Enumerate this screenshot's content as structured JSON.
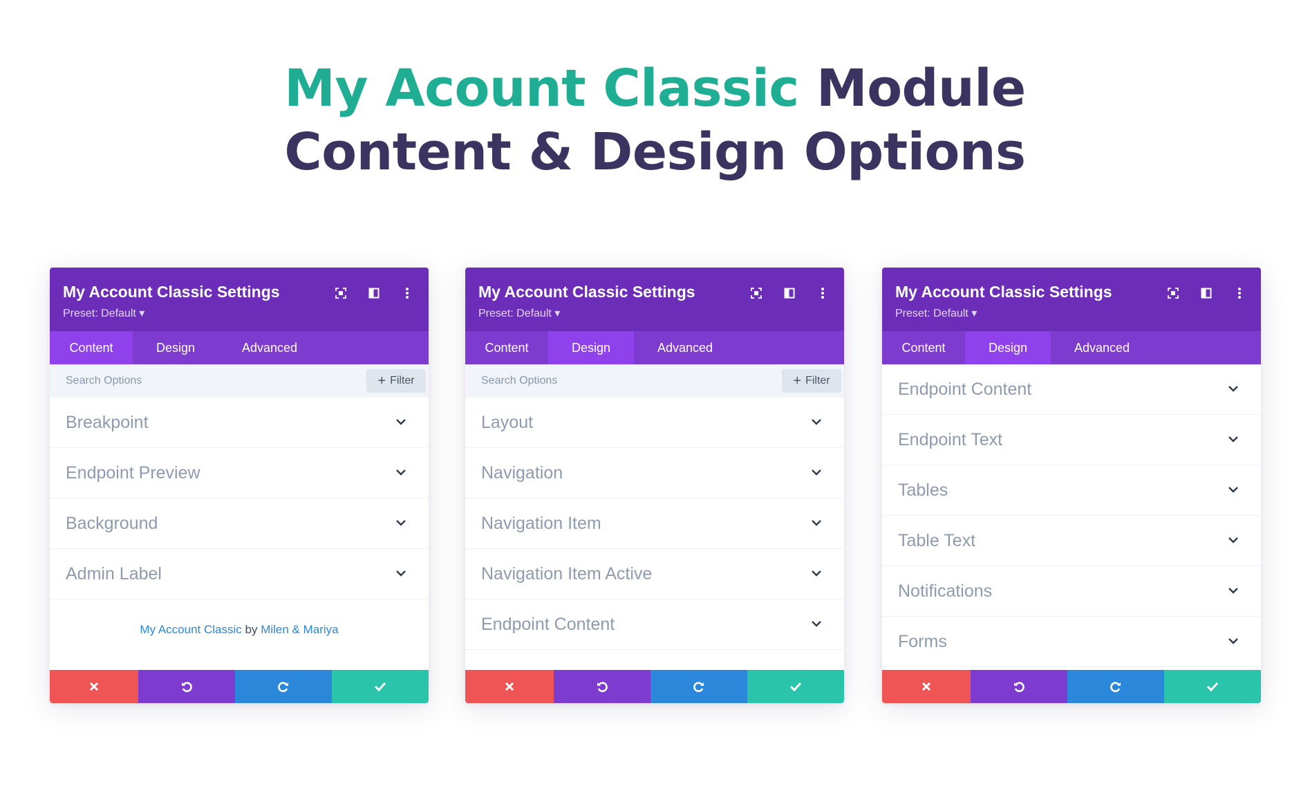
{
  "heading": {
    "line1_accent": "My Acount Classic",
    "line1_rest": " Module",
    "line2": "Content & Design Options"
  },
  "colors": {
    "accent": "#1fae94",
    "heading": "#3b3461",
    "header": "#6c2eb9",
    "tabs": "#7e3bd0",
    "tab_active": "#8f42ec",
    "cancel": "#ef5555",
    "undo": "#7e3bd0",
    "redo": "#2b87da",
    "save": "#29c4a9"
  },
  "icons": {
    "header": [
      "expand-icon",
      "split-view-icon",
      "more-options-icon"
    ],
    "footer": [
      "close-icon",
      "undo-icon",
      "redo-icon",
      "check-icon"
    ]
  },
  "panels": [
    {
      "title": "My Account Classic Settings",
      "preset": "Preset: Default",
      "tabs": [
        "Content",
        "Design",
        "Advanced"
      ],
      "active_tab": "Content",
      "search_placeholder": "Search Options",
      "filter_label": "Filter",
      "options": [
        "Breakpoint",
        "Endpoint Preview",
        "Background",
        "Admin Label"
      ],
      "credit": {
        "module": "My Account Classic",
        "by": " by ",
        "author": "Milen & Mariya"
      }
    },
    {
      "title": "My Account Classic Settings",
      "preset": "Preset: Default",
      "tabs": [
        "Content",
        "Design",
        "Advanced"
      ],
      "active_tab": "Design",
      "search_placeholder": "Search Options",
      "filter_label": "Filter",
      "options": [
        "Layout",
        "Navigation",
        "Navigation Item",
        "Navigation Item Active",
        "Endpoint Content"
      ]
    },
    {
      "title": "My Account Classic Settings",
      "preset": "Preset: Default",
      "tabs": [
        "Content",
        "Design",
        "Advanced"
      ],
      "active_tab": "Design",
      "options": [
        "Endpoint Content",
        "Endpoint Text",
        "Tables",
        "Table Text",
        "Notifications",
        "Forms"
      ]
    }
  ]
}
